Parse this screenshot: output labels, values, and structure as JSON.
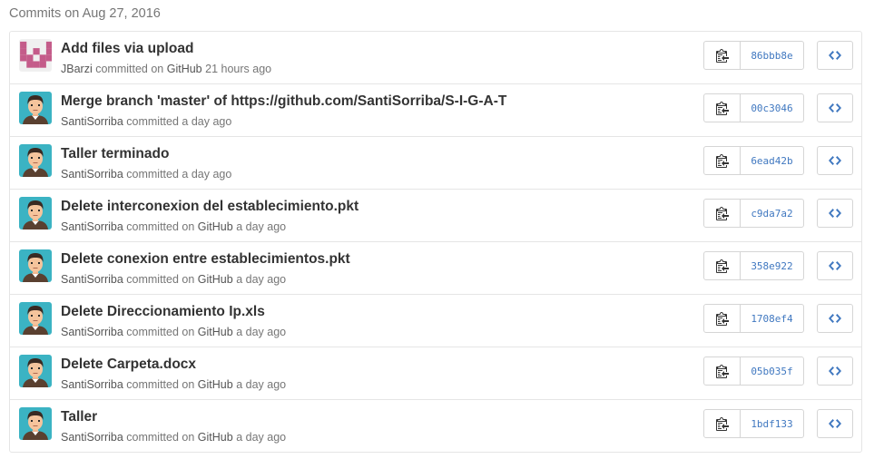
{
  "group_title": "Commits on Aug 27, 2016",
  "colors": {
    "link": "#4078c0",
    "muted": "#767676",
    "border": "#e5e5e5"
  },
  "icons": {
    "copy": "clippy-icon",
    "browse": "code-icon"
  },
  "commits": [
    {
      "message": "Add files via upload",
      "author": "JBarzi",
      "action": "committed on",
      "committer": "GitHub",
      "time": "21 hours ago",
      "sha": "86bbb8e",
      "avatar": "identicon"
    },
    {
      "message": "Merge branch 'master' of https://github.com/SantiSorriba/S-I-G-A-T",
      "author": "SantiSorriba",
      "action": "committed",
      "committer": "",
      "time": "a day ago",
      "sha": "00c3046",
      "avatar": "person"
    },
    {
      "message": "Taller terminado",
      "author": "SantiSorriba",
      "action": "committed",
      "committer": "",
      "time": "a day ago",
      "sha": "6ead42b",
      "avatar": "person"
    },
    {
      "message": "Delete interconexion del establecimiento.pkt",
      "author": "SantiSorriba",
      "action": "committed on",
      "committer": "GitHub",
      "time": "a day ago",
      "sha": "c9da7a2",
      "avatar": "person"
    },
    {
      "message": "Delete conexion entre establecimientos.pkt",
      "author": "SantiSorriba",
      "action": "committed on",
      "committer": "GitHub",
      "time": "a day ago",
      "sha": "358e922",
      "avatar": "person"
    },
    {
      "message": "Delete Direccionamiento Ip.xls",
      "author": "SantiSorriba",
      "action": "committed on",
      "committer": "GitHub",
      "time": "a day ago",
      "sha": "1708ef4",
      "avatar": "person"
    },
    {
      "message": "Delete Carpeta.docx",
      "author": "SantiSorriba",
      "action": "committed on",
      "committer": "GitHub",
      "time": "a day ago",
      "sha": "05b035f",
      "avatar": "person"
    },
    {
      "message": "Taller",
      "author": "SantiSorriba",
      "action": "committed on",
      "committer": "GitHub",
      "time": "a day ago",
      "sha": "1bdf133",
      "avatar": "person"
    }
  ]
}
